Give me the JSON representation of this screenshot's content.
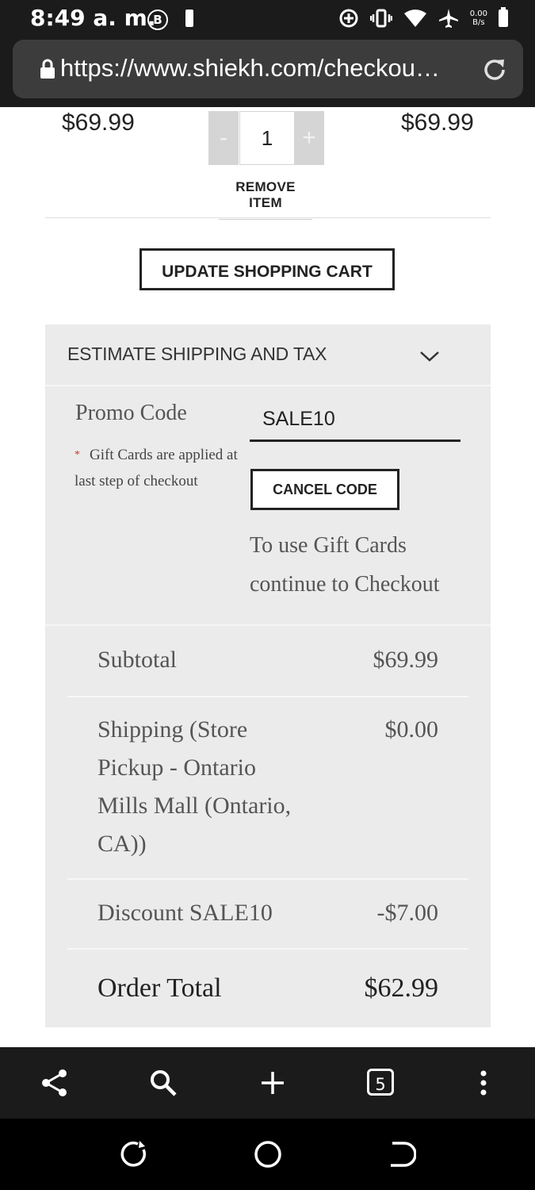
{
  "status_bar": {
    "time": "8:49 a. m.",
    "b_badge": "B",
    "net_speed_value": "0.00",
    "net_speed_unit": "B/s"
  },
  "address_bar": {
    "url": "https://www.shiekh.com/checkout/c..."
  },
  "cart_item": {
    "price": "$69.99",
    "quantity": "1",
    "minus_label": "-",
    "plus_label": "+",
    "row_total": "$69.99",
    "remove_label": "REMOVE ITEM"
  },
  "cart_actions": {
    "update_label": "UPDATE SHOPPING CART"
  },
  "shipping": {
    "header": "ESTIMATE SHIPPING AND TAX"
  },
  "promo": {
    "label": "Promo Code",
    "value": "SALE10",
    "note_star": "*",
    "note": "Gift Cards are applied at last step of checkout",
    "cancel_label": "CANCEL CODE",
    "gift_info": "To use Gift Cards continue to Checkout"
  },
  "totals": {
    "subtotal_label": "Subtotal",
    "subtotal_value": "$69.99",
    "shipping_label": "Shipping (Store Pickup - Ontario Mills Mall  (Ontario, CA))",
    "shipping_value": "$0.00",
    "discount_label": "Discount SALE10",
    "discount_value": "-$7.00",
    "order_total_label": "Order Total",
    "order_total_value": "$62.99"
  },
  "toolbar": {
    "tab_count": "5"
  },
  "icons": {
    "status": [
      "b-badge-icon",
      "battery-small-icon",
      "data-saver-icon",
      "vibrate-icon",
      "wifi-icon",
      "airplane-icon",
      "battery-icon"
    ],
    "toolbar": [
      "share-icon",
      "search-icon",
      "new-tab-icon",
      "tab-switcher-icon",
      "more-menu-icon"
    ],
    "navigation": [
      "recents-icon",
      "home-icon",
      "back-icon"
    ]
  },
  "colors": {
    "chrome_bg": "#1b1b1b",
    "url_bar_bg": "#3c3c3c",
    "panel_bg": "#ebebeb",
    "required_star": "#c0392b"
  }
}
